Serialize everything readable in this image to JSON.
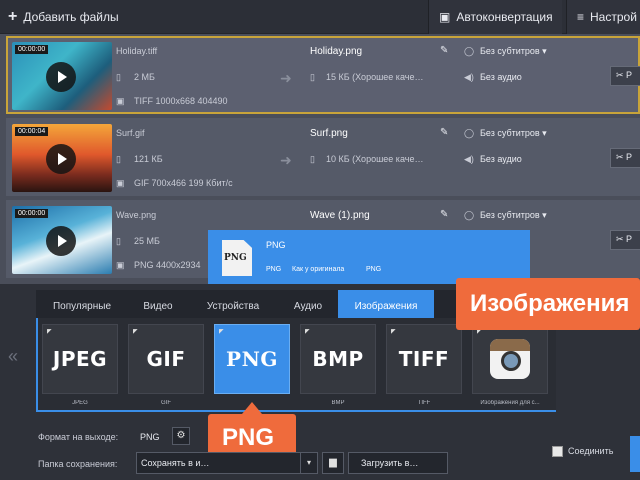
{
  "toolbar": {
    "add_files": "Добавить файлы",
    "auto_convert": "Автоконвертация",
    "settings": "Настрой"
  },
  "files": [
    {
      "duration": "00:00:00",
      "src_name": "Holiday.tiff",
      "src_size": "2 МБ",
      "src_meta": "TIFF 1000x668 404490",
      "dst_name": "Holiday.png",
      "dst_size": "15 КБ (Хорошее каче…",
      "subtitles": "Без субтитров",
      "audio": "Без аудио",
      "cut": "Р"
    },
    {
      "duration": "00:00:04",
      "src_name": "Surf.gif",
      "src_size": "121 КБ",
      "src_meta": "GIF 700x466 199 Кбит/с",
      "dst_name": "Surf.png",
      "dst_size": "10 КБ (Хорошее каче…",
      "subtitles": "Без субтитров",
      "audio": "Без аудио",
      "cut": "Р"
    },
    {
      "duration": "00:00:00",
      "src_name": "Wave.png",
      "src_size": "25 МБ",
      "src_meta": "PNG 4400x2934",
      "dst_name": "Wave (1).png",
      "subtitles": "Без субтитров",
      "cut": "Р"
    }
  ],
  "popup": {
    "icon_text": "PNG",
    "title": "PNG",
    "sub1": "PNG",
    "sub2": "Как у оригинала",
    "sub3": "PNG"
  },
  "tabs": [
    {
      "label": "Популярные"
    },
    {
      "label": "Видео"
    },
    {
      "label": "Устройства"
    },
    {
      "label": "Аудио"
    },
    {
      "label": "Изображения"
    }
  ],
  "presets": [
    {
      "logo": "JPEG",
      "label": "JPEG"
    },
    {
      "logo": "GIF",
      "label": "GIF"
    },
    {
      "logo": "PNG",
      "label": ""
    },
    {
      "logo": "BMP",
      "label": "BMP"
    },
    {
      "logo": "TIFF",
      "label": "TIFF"
    },
    {
      "logo": "",
      "label": "Изображения для с..."
    }
  ],
  "callouts": {
    "images": "Изображения",
    "png": "PNG"
  },
  "output": {
    "format_label": "Формат на выходе:",
    "format_value": "PNG",
    "save_label": "Папка сохранения:",
    "save_value": "Сохранять в и…",
    "upload": "Загрузить в…",
    "merge": "Соединить"
  },
  "colors": {
    "accent": "#3a8ee8",
    "callout": "#ef6b3c",
    "selected_border": "#c8a43a"
  }
}
